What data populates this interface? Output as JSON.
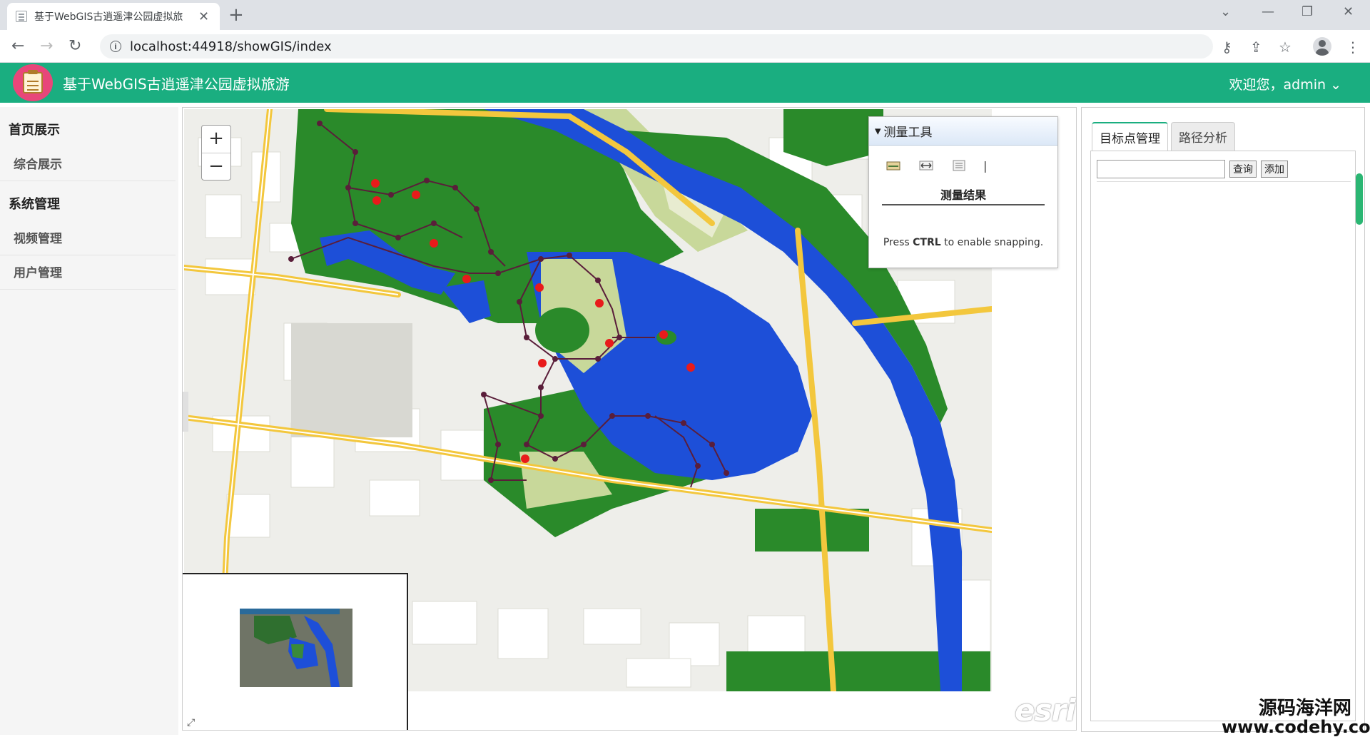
{
  "browser": {
    "tab_title": "基于WebGIS古逍遥津公园虚拟旅",
    "url": "localhost:44918/showGIS/index"
  },
  "header": {
    "title": "基于WebGIS古逍遥津公园虚拟旅游",
    "user_menu": "欢迎您，admin"
  },
  "sidebar": {
    "groups": [
      {
        "label": "首页展示",
        "items": [
          {
            "label": "综合展示"
          }
        ]
      },
      {
        "label": "系统管理",
        "items": [
          {
            "label": "视频管理"
          },
          {
            "label": "用户管理"
          }
        ]
      }
    ]
  },
  "map": {
    "zoom_in": "+",
    "zoom_out": "−",
    "logo_text": "esri",
    "colors": {
      "water": "#1d4fd8",
      "park": "#2a8a2a",
      "urban": "#eeeeea",
      "road": "#f3c73d"
    }
  },
  "measure": {
    "title": "测量工具",
    "result_label": "测量结果",
    "tip_prefix": "Press ",
    "tip_key": "CTRL",
    "tip_suffix": " to enable snapping."
  },
  "right_panel": {
    "tabs": [
      {
        "label": "目标点管理",
        "active": true
      },
      {
        "label": "路径分析",
        "active": false
      }
    ],
    "search_value": "",
    "search_button": "查询",
    "add_button": "添加"
  },
  "watermark": {
    "line1": "源码海洋网",
    "line2": "www.codehy.com"
  }
}
